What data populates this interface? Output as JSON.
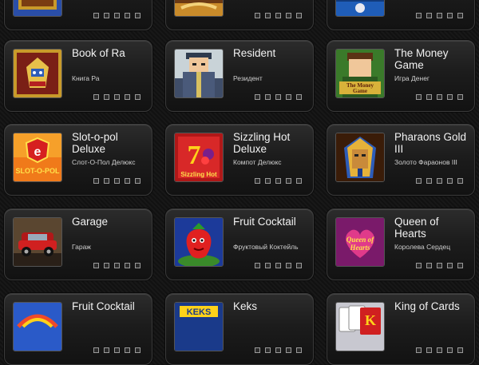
{
  "games": [
    {
      "title": "",
      "subtitle": "",
      "thumb_icon": "book-of-ra-deluxe-icon"
    },
    {
      "title": "",
      "subtitle": "",
      "thumb_icon": "columbus-icon"
    },
    {
      "title": "",
      "subtitle": "",
      "thumb_icon": "pearl-icon"
    },
    {
      "title": "Book of Ra",
      "subtitle": "Книга Ра",
      "thumb_icon": "book-of-ra-icon"
    },
    {
      "title": "Resident",
      "subtitle": "Резидент",
      "thumb_icon": "resident-icon"
    },
    {
      "title": "The Money Game",
      "subtitle": "Игра Денег",
      "thumb_icon": "money-game-icon",
      "thumb_text": "The Money Game"
    },
    {
      "title": "Slot-o-pol Deluxe",
      "subtitle": "Слот-О-Пол Делюкс",
      "thumb_icon": "slot-o-pol-icon",
      "thumb_text": "SLOT-O-POL"
    },
    {
      "title": "Sizzling Hot Deluxe",
      "subtitle": "Компот Делюкс",
      "thumb_icon": "sizzling-hot-icon",
      "thumb_text": "Sizzling Hot"
    },
    {
      "title": "Pharaons Gold III",
      "subtitle": "Золото Фараонов III",
      "thumb_icon": "pharaoh-icon"
    },
    {
      "title": "Garage",
      "subtitle": "Гараж",
      "thumb_icon": "garage-car-icon"
    },
    {
      "title": "Fruit Cocktail",
      "subtitle": "Фруктовый Коктейль",
      "thumb_icon": "strawberry-icon"
    },
    {
      "title": "Queen of Hearts",
      "subtitle": "Королева Сердец",
      "thumb_icon": "queen-of-hearts-icon",
      "thumb_text": "Queen of Hearts"
    },
    {
      "title": "Fruit Cocktail",
      "subtitle": "",
      "thumb_icon": "fruit-cocktail-icon"
    },
    {
      "title": "Keks",
      "subtitle": "",
      "thumb_icon": "keks-icon",
      "thumb_text": "KEKS"
    },
    {
      "title": "King of Cards",
      "subtitle": "",
      "thumb_icon": "king-of-cards-icon"
    }
  ]
}
